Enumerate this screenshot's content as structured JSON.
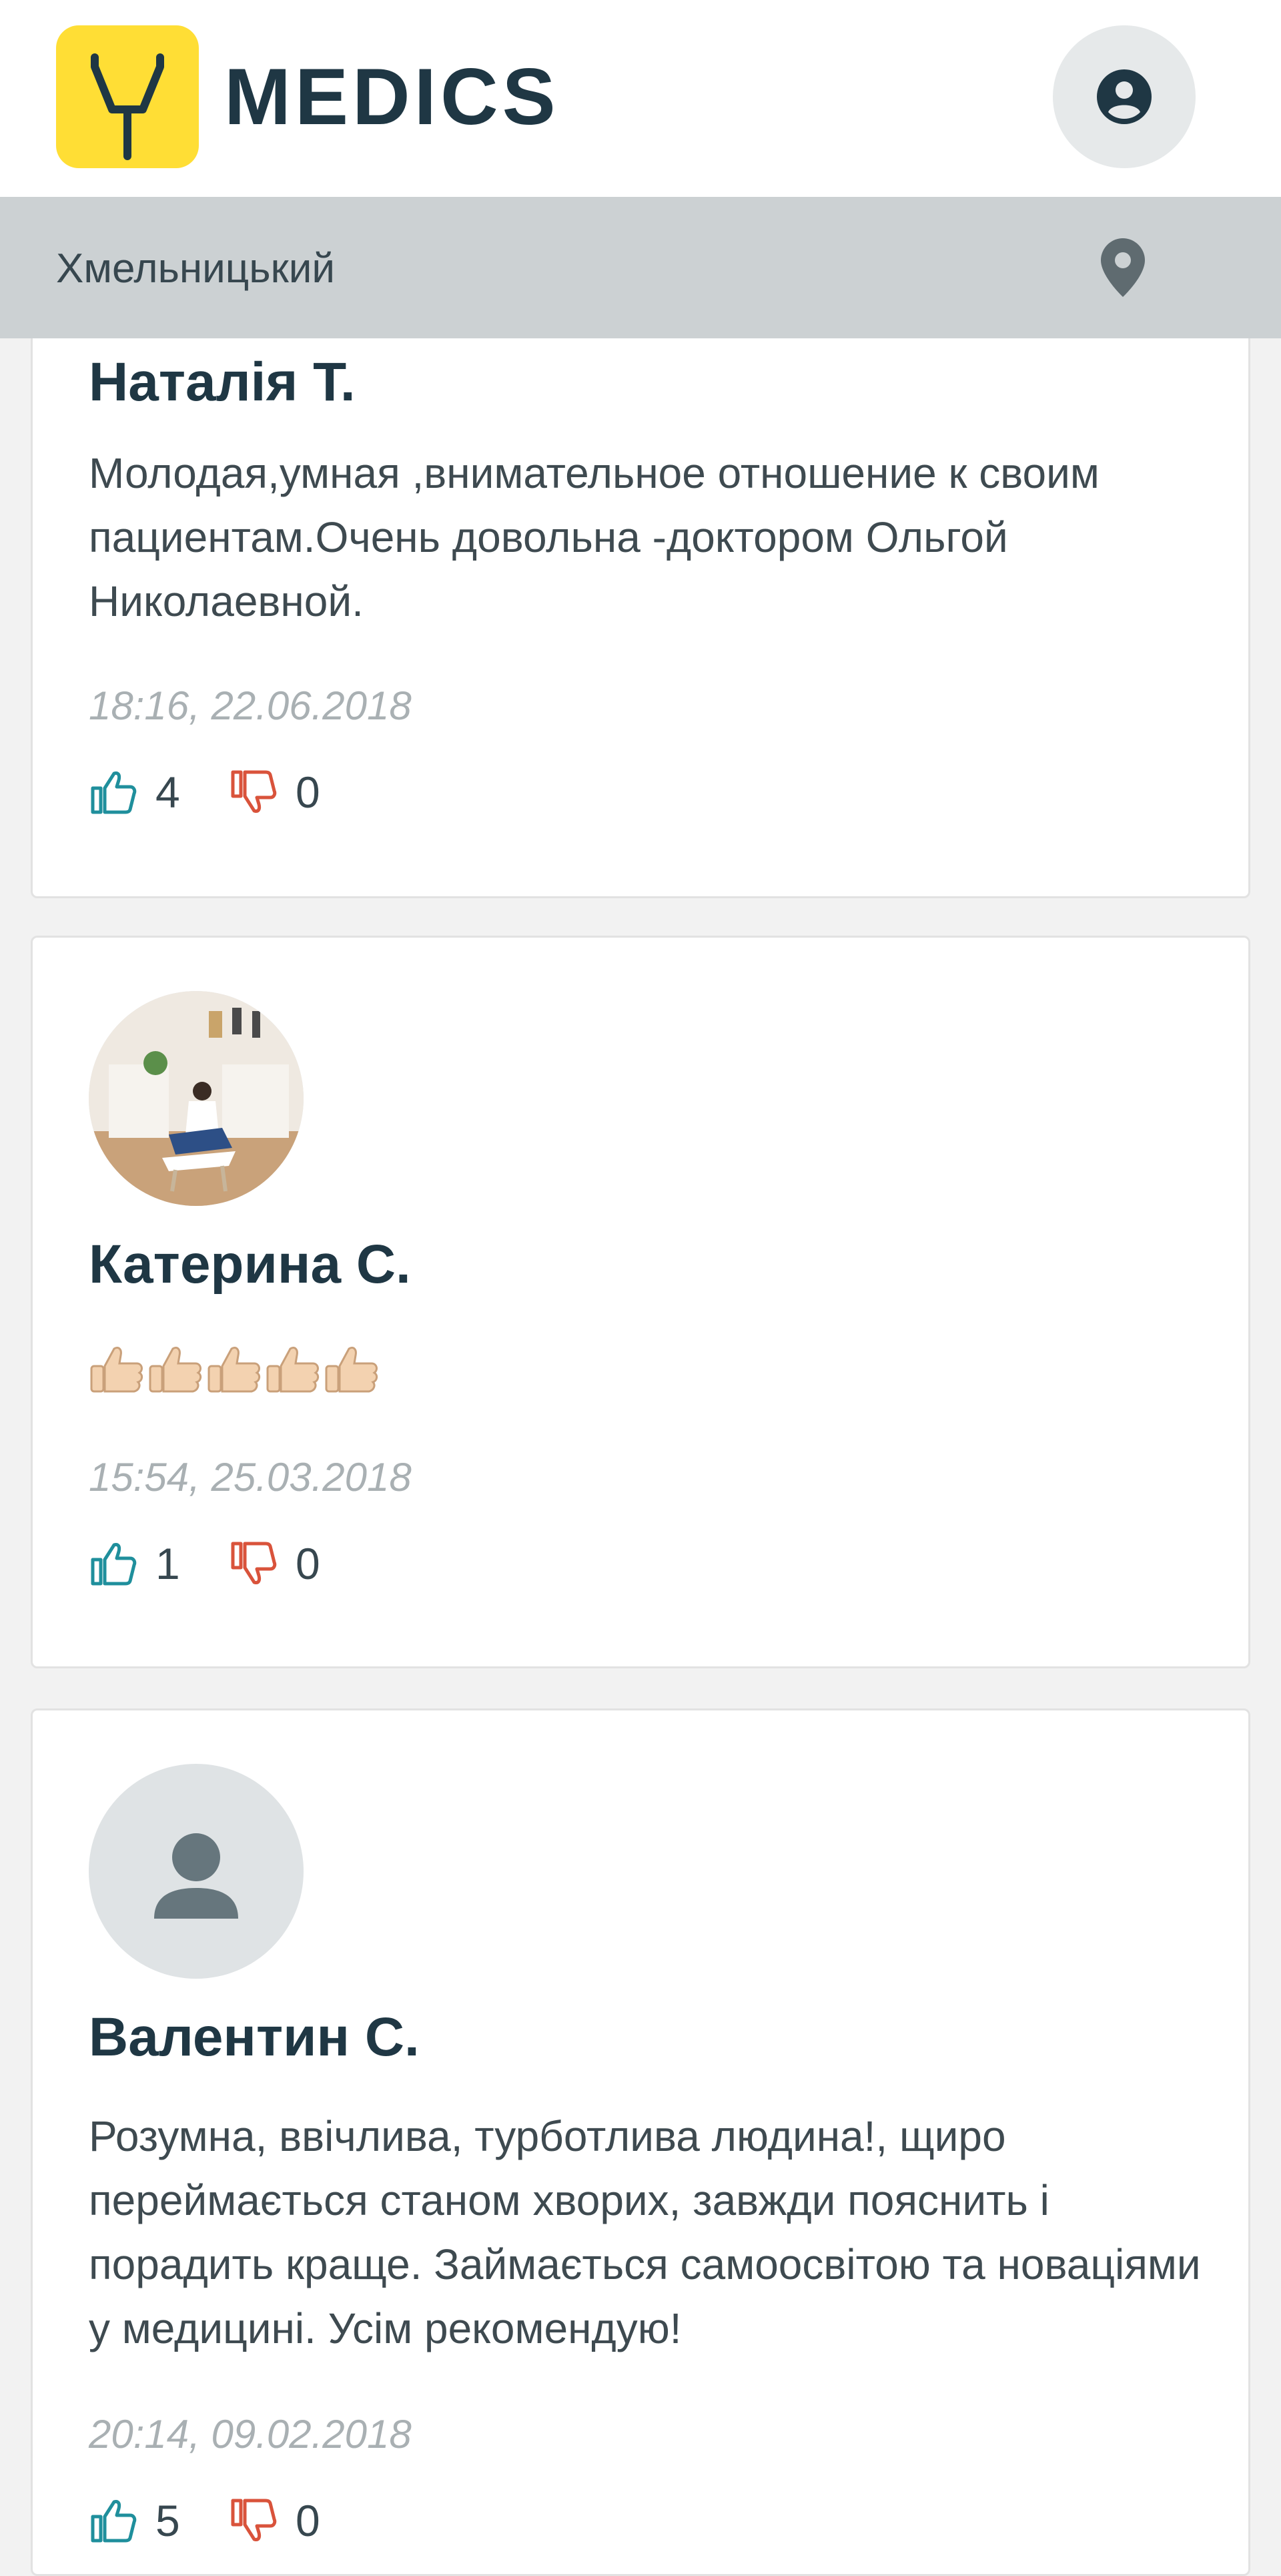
{
  "header": {
    "brand": "MEDICS"
  },
  "location": {
    "city": "Хмельницький"
  },
  "reviews": [
    {
      "name": "Наталія Т.",
      "text": "Молодая,умная ,внимательное отношение к своим пациентам.Очень довольна -доктором Ольгой Николаевной.",
      "date": "18:16, 22.06.2018",
      "likes": "4",
      "dislikes": "0"
    },
    {
      "name": "Катерина С.",
      "text": "",
      "emoji_count": 5,
      "date": "15:54, 25.03.2018",
      "likes": "1",
      "dislikes": "0"
    },
    {
      "name": "Валентин С.",
      "text": "Розумна, ввічлива, турботлива людина!, щиро переймається станом хворих, завжди пояснить і порадить краще. Займається самоосвітою та новаціями у медицині. Усім рекомендую!",
      "date": "20:14, 09.02.2018",
      "likes": "5",
      "dislikes": "0"
    }
  ],
  "colors": {
    "accent": "#ffde35",
    "like": "#1f8f9c",
    "dislike": "#d9533b"
  }
}
